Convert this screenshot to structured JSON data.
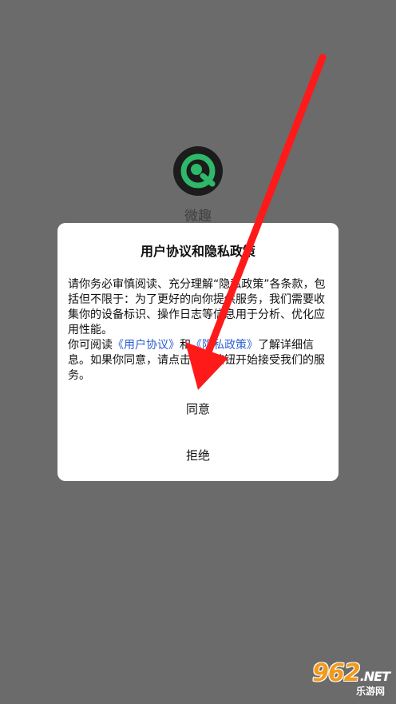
{
  "app": {
    "name": "微趣"
  },
  "dialog": {
    "title": "用户协议和隐私政策",
    "paragraph1": "请你务必审慎阅读、充分理解“隐私政策”各条款，包括但不限于：为了更好的向你提供服务，我们需要收集你的设备标识、操作日志等信息用于分析、优化应用性能。",
    "p2_prefix": "你可阅读",
    "user_agreement_link": "《用户协议》",
    "p2_and": "和",
    "privacy_policy_link": "《隐私政策》",
    "p2_suffix": "了解详细信息。如果你同意，请点击下面按钮开始接受我们的服务。",
    "agree_label": "同意",
    "reject_label": "拒绝"
  },
  "watermark": {
    "number": "962",
    "domain": ".NET",
    "site": "乐游网"
  },
  "colors": {
    "overlay": "#6b6b6b",
    "link": "#2f5fd0",
    "arrow": "#ff1a1a",
    "logo_green": "#2fb86a"
  }
}
